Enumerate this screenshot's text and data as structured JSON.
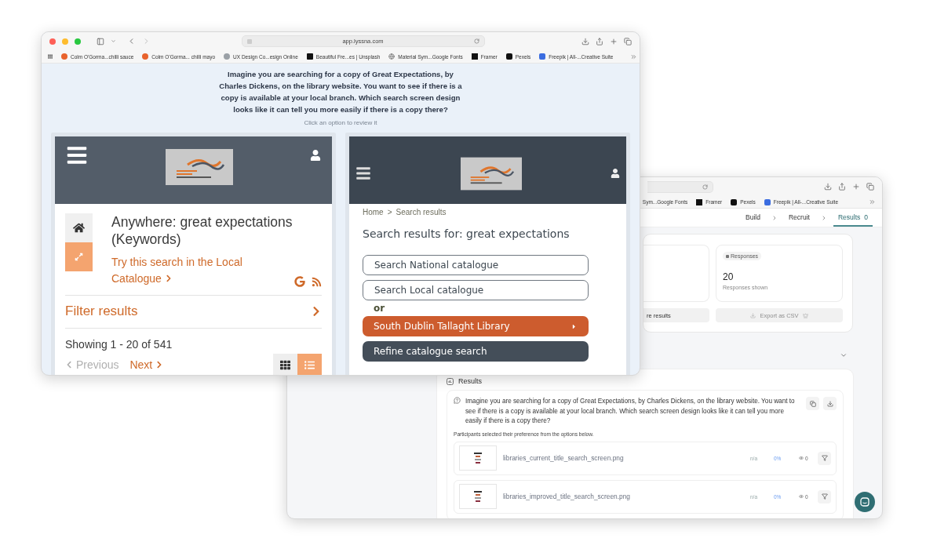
{
  "front_window": {
    "url": "app.lyssna.com",
    "bookmarks": [
      "Colm O'Gorma...chilli sauce",
      "Colm O'Gorma... chilli mayo",
      "UX Design Co...esign Online",
      "Beautiful Fre...es | Unsplash",
      "Material Sym...Google Fonts",
      "Framer",
      "Pexels",
      "Freepik | All-...Creative Suite"
    ],
    "question": "Imagine you are searching for a copy of Great Expectations, by Charles Dickens, on the library website. You want to see if there is a copy is available at your local branch. Which search screen design looks like it can tell you more easily if there is a copy there?",
    "hint": "Click an option to review it",
    "options": [
      {
        "kind": "current",
        "title": "Anywhere: great expectations (Keywords)",
        "link": "Try this search in the Local Catalogue",
        "filter": "Filter results",
        "showing": "Showing 1 - 20 of 541",
        "previous": {
          "label": "Previous",
          "disabled": true
        },
        "next": {
          "label": "Next",
          "disabled": false
        },
        "views": [
          {
            "selected": false
          },
          {
            "selected": true
          }
        ]
      },
      {
        "kind": "improved",
        "breadcrumb": [
          "Home",
          ">",
          "Search results"
        ],
        "heading": "Search results for: great expectations",
        "actions": [
          {
            "kind": "outline",
            "label": "Search National catalogue"
          },
          {
            "kind": "outline",
            "label": "Search Local catalogue"
          },
          {
            "kind": "text",
            "label": "or"
          },
          {
            "kind": "primary",
            "label": "South Dublin Tallaght Library"
          },
          {
            "kind": "dark",
            "label": "Refine catalogue search"
          }
        ]
      }
    ]
  },
  "back_window": {
    "bookmarks": [
      "Sym...Google Fonts",
      "Framer",
      "Pexels",
      "Freepik | All-...Creative Suite"
    ],
    "steps": [
      {
        "label": "Build",
        "selected": false
      },
      {
        "label": "Recruit",
        "selected": false
      },
      {
        "label": "Results",
        "count": "0",
        "selected": true
      }
    ],
    "partial_button": "re results",
    "responses": {
      "tag": "Responses",
      "value": "20",
      "caption": "Responses shown"
    },
    "export": {
      "label": "Export as CSV",
      "disabled": true
    },
    "results": {
      "title": "Results",
      "question": "Imagine you are searching for a copy of Great Expectations, by Charles Dickens, on the library website. You want to see if there is a copy is available at your local branch. Which search screen design looks like it can tell you more easily if there is a copy there?",
      "note": "Participants selected their preference from the options below.",
      "rows": [
        {
          "file": "libraries_current_title_search_screen.png",
          "na": "n/a",
          "percent": "0%",
          "views": "0"
        },
        {
          "file": "libraries_improved_title_search_screen.png",
          "na": "n/a",
          "percent": "0%",
          "views": "0"
        }
      ]
    }
  }
}
